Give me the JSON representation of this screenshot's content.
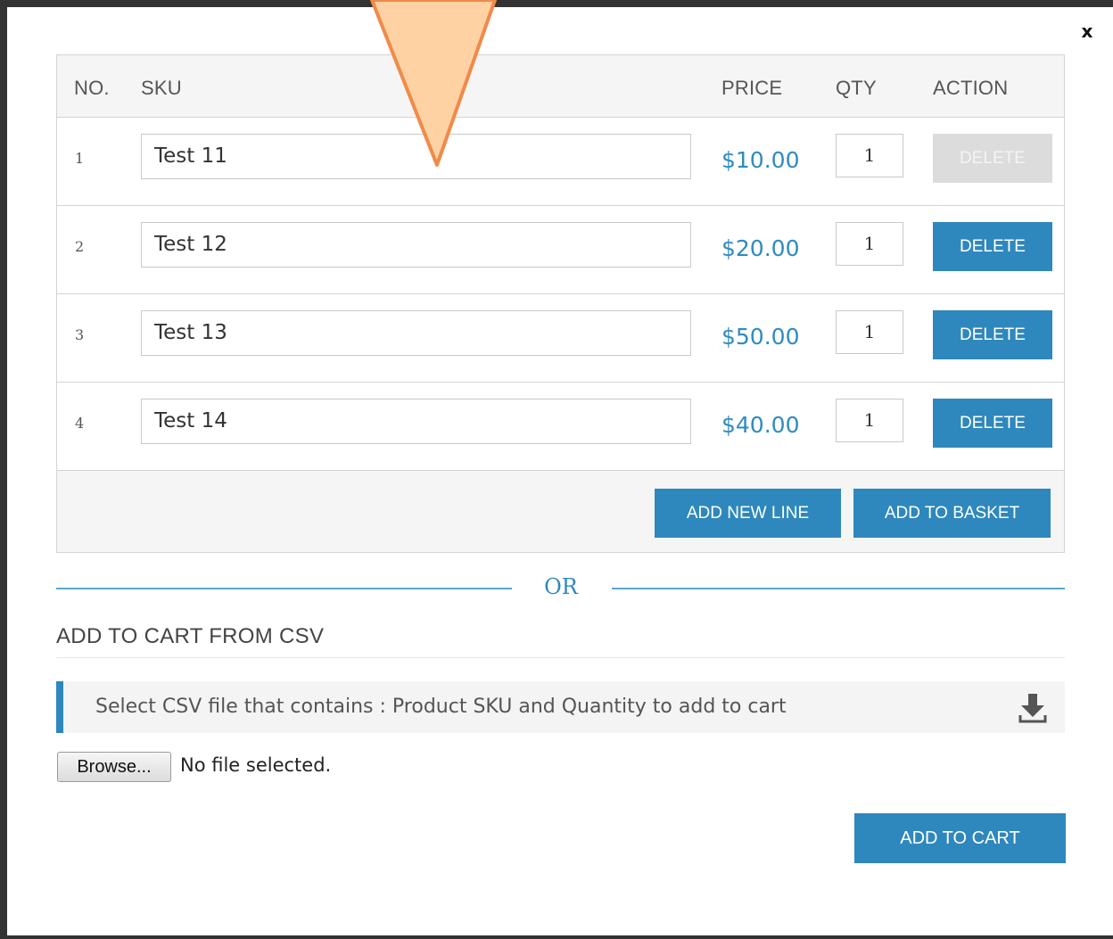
{
  "modal": {
    "close_label": "x"
  },
  "table": {
    "headers": {
      "no": "NO.",
      "sku": "SKU",
      "price": "PRICE",
      "qty": "QTY",
      "action": "ACTION"
    },
    "rows": [
      {
        "no": "1",
        "sku": "Test 11",
        "price": "$10.00",
        "qty": "1",
        "action": "DELETE",
        "action_disabled": true
      },
      {
        "no": "2",
        "sku": "Test 12",
        "price": "$20.00",
        "qty": "1",
        "action": "DELETE",
        "action_disabled": false
      },
      {
        "no": "3",
        "sku": "Test 13",
        "price": "$50.00",
        "qty": "1",
        "action": "DELETE",
        "action_disabled": false
      },
      {
        "no": "4",
        "sku": "Test 14",
        "price": "$40.00",
        "qty": "1",
        "action": "DELETE",
        "action_disabled": false
      }
    ],
    "add_new_line_label": "ADD NEW LINE",
    "add_to_basket_label": "ADD TO BASKET"
  },
  "separator": {
    "text": "OR"
  },
  "csv": {
    "heading": "ADD TO CART FROM CSV",
    "info_text": "Select CSV file that contains : Product SKU and Quantity to add to cart",
    "info_icon": "download-icon",
    "browse_label": "Browse...",
    "file_status": "No file selected.",
    "add_to_cart_label": "ADD TO CART"
  },
  "colors": {
    "accent": "#2e88bd",
    "price": "#2e8bc0",
    "disabled": "#dcdcdc",
    "arrow_fill": "#ffd2a3",
    "arrow_stroke": "#f08a4b"
  }
}
